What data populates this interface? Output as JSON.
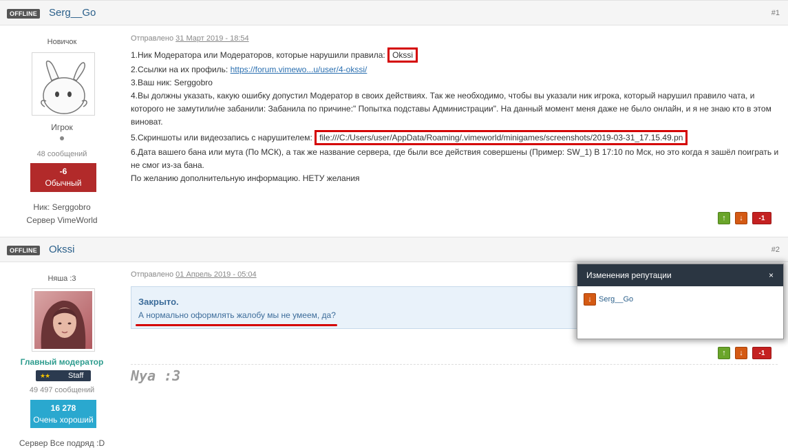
{
  "posts": [
    {
      "status_badge": "OFFLINE",
      "author": "Serg__Go",
      "number": "#1",
      "rank_title": "Новичок",
      "group": "Игрок",
      "posts_count": "48 сообщений",
      "reputation_value": "-6",
      "reputation_label": "Обычный",
      "reputation_color": "#b22a2a",
      "extra_1": "Ник: Serggobro",
      "extra_2": "Сервер VimeWorld",
      "posted_prefix": "Отправлено",
      "posted_date": "31 Март 2019 - 18:54",
      "lines": {
        "l1": "1.Ник Модератора или Модераторов, которые нарушили правила:",
        "l1_hl": "Okssi",
        "l2": "2.Ссылки на их профиль:",
        "l2_link": "https://forum.vimewo...u/user/4-okssi/",
        "l3": "3.Ваш ник: Serggobro",
        "l4": "4.Вы должны указать, какую ошибку допустил Модератор в своих действиях. Так же необходимо, чтобы вы указали ник игрока, который нарушил правило чата, и которого не замутили/не забанили: Забанила по причине:\" Попытка подставы Администрации\". На данный момент меня даже не было онлайн, и я не знаю кто в этом виноват.",
        "l5": "5.Скриншоты или видеозапись с нарушителем:",
        "l5_hl": "file:///C:/Users/user/AppData/Roaming/.vimeworld/minigames/screenshots/2019-03-31_17.15.49.pn",
        "l6": "6.Дата вашего бана или мута (По МСК), а так же название сервера, где были все действия совершены (Пример: SW_1) В 17:10 по Мск, но это когда я зашёл поиграть и не смог из-за бана.",
        "l7": "По желанию дополнительную информацию. НЕТУ желания"
      },
      "rep_up": "↑",
      "rep_down": "↓",
      "rep_value": "-1"
    },
    {
      "status_badge": "OFFLINE",
      "author": "Okssi",
      "number": "#2",
      "rank_title": "Няша :3",
      "group": "Главный модератор",
      "group_color": "#2e9c8e",
      "staff_stars": "★★",
      "staff_label": "Staff",
      "posts_count": "49 497 сообщений",
      "reputation_value": "16 278",
      "reputation_label": "Очень хороший",
      "reputation_color": "#2aa8cf",
      "extra_1": "Сервер Все подряд :D",
      "posted_prefix": "Отправлено",
      "posted_date": "01 Апрель 2019 - 05:04",
      "closed_title": "Закрыто.",
      "closed_text": "А нормально оформлять жалобу мы не умеем, да?",
      "signature": "Nya :3",
      "rep_up": "↑",
      "rep_down": "↓",
      "rep_value": "-1"
    }
  ],
  "popup": {
    "title": "Изменения репутации",
    "close": "×",
    "entry_user": "Serg__Go",
    "entry_icon": "↓"
  }
}
